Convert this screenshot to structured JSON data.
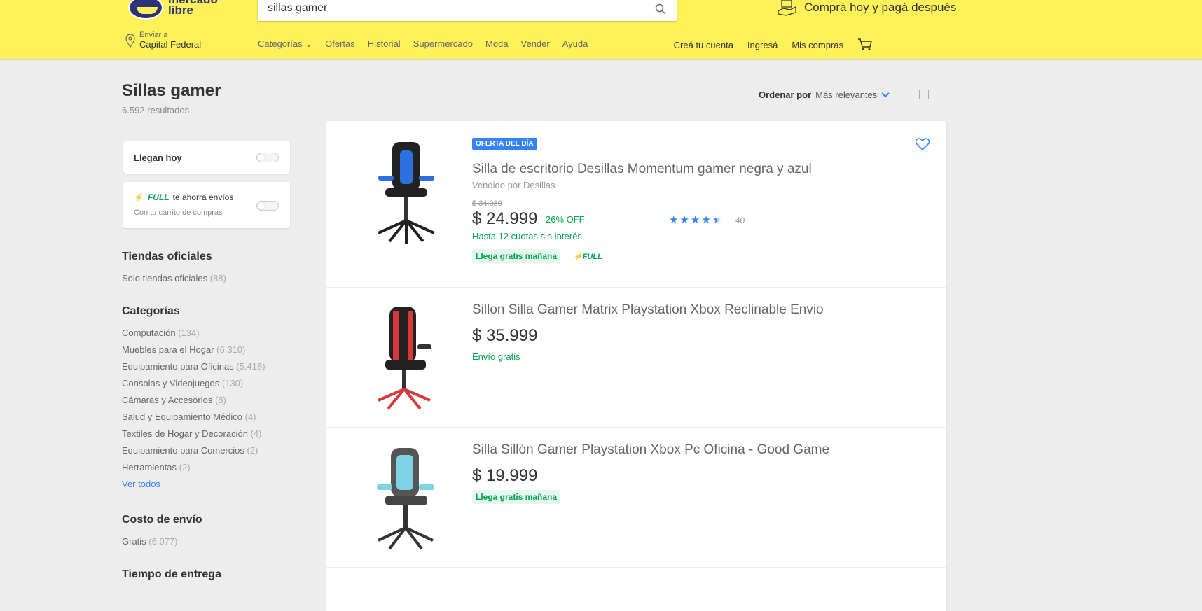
{
  "header": {
    "logo_text": "mercado\nlibre",
    "search": {
      "value": "sillas gamer"
    },
    "promo": "Comprá hoy y pagá después",
    "location": {
      "small": "Enviar a",
      "big": "Capital Federal"
    },
    "nav": [
      "Categorías ⌄",
      "Ofertas",
      "Historial",
      "Supermercado",
      "Moda",
      "Vender",
      "Ayuda"
    ],
    "account": {
      "create": "Creá tu cuenta",
      "login": "Ingresá",
      "purchases": "Mis compras"
    }
  },
  "page": {
    "title": "Sillas gamer",
    "results": "6.592 resultados"
  },
  "sort": {
    "label": "Ordenar por",
    "value": "Más relevantes"
  },
  "filters": {
    "arrive_today": "Llegan hoy",
    "full_label": "FULL",
    "full_text": "te ahorra envíos",
    "full_sub": "Con tu carrito de compras",
    "official": {
      "title": "Tiendas oficiales",
      "item": "Solo tiendas oficiales",
      "count": "(88)"
    },
    "categories": {
      "title": "Categorías",
      "items": [
        {
          "name": "Computación",
          "count": "(134)"
        },
        {
          "name": "Muebles para el Hogar",
          "count": "(6.310)"
        },
        {
          "name": "Equipamiento para Oficinas",
          "count": "(5.418)"
        },
        {
          "name": "Consolas y Videojuegos",
          "count": "(130)"
        },
        {
          "name": "Cámaras y Accesorios",
          "count": "(8)"
        },
        {
          "name": "Salud y Equipamiento Médico",
          "count": "(4)"
        },
        {
          "name": "Textiles de Hogar y Decoración",
          "count": "(4)"
        },
        {
          "name": "Equipamiento para Comercios",
          "count": "(2)"
        },
        {
          "name": "Herramientas",
          "count": "(2)"
        }
      ],
      "see_all": "Ver todos"
    },
    "shipping": {
      "title": "Costo de envío",
      "item": "Gratis",
      "count": "(6.077)"
    },
    "delivery": {
      "title": "Tiempo de entrega"
    }
  },
  "products": [
    {
      "badge": "OFERTA DEL DÍA",
      "title": "Silla de escritorio Desillas Momentum gamer negra y azul",
      "seller": "Vendido por Desillas",
      "old_price": "$ 34.080",
      "price": "$ 24.999",
      "discount": "26% OFF",
      "installments": "Hasta 12 cuotas sin interés",
      "shipping": "Llega gratis mañana",
      "full": "FULL",
      "rating": 4.5,
      "reviews": "40",
      "accent": "#2b6fe0"
    },
    {
      "title": "Sillon Silla Gamer Matrix Playstation Xbox Reclinable Envio",
      "price": "$ 35.999",
      "shipping": "Envío gratis",
      "accent": "#d9383a"
    },
    {
      "title": "Silla Sillón Gamer Playstation Xbox Pc Oficina - Good Game",
      "price": "$ 19.999",
      "shipping": "Llega gratis mañana",
      "accent": "#7fd3e6"
    }
  ],
  "colors": {
    "brand_yellow": "#fff159",
    "blue": "#3483fa",
    "green": "#00a650"
  }
}
